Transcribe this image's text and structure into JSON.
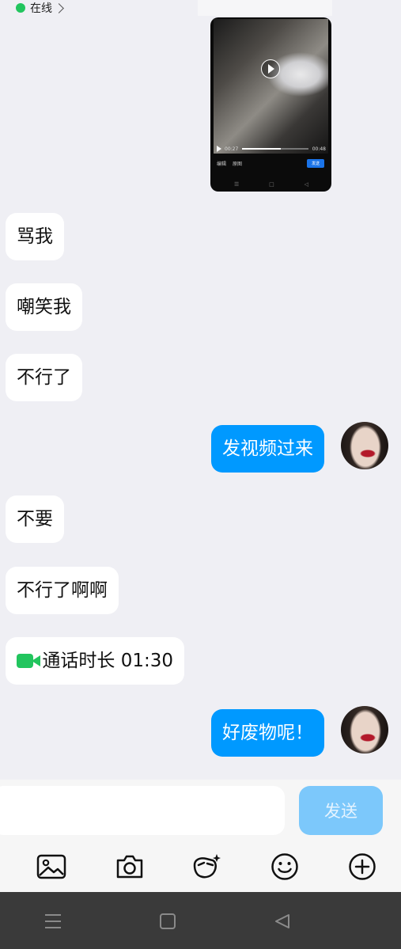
{
  "status": {
    "online_label": "在线"
  },
  "shared_screenshot": {
    "time_current": "00:27",
    "time_total": "00:48",
    "progress": 0.58,
    "edit_label": "编辑",
    "original_label": "原图",
    "send_label": "发送"
  },
  "messages": [
    {
      "side": "in",
      "text": "骂我"
    },
    {
      "side": "in",
      "text": "嘲笑我"
    },
    {
      "side": "in",
      "text": "不行了"
    },
    {
      "side": "out",
      "text": "发视频过来"
    },
    {
      "side": "in",
      "text": "不要"
    },
    {
      "side": "in",
      "text": "不行了啊啊"
    },
    {
      "side": "in",
      "text": "通话时长 01:30"
    },
    {
      "side": "out",
      "text": "好废物呢！"
    }
  ],
  "composer": {
    "input_value": "",
    "send_label": "发送"
  },
  "toolbar_icons": [
    "image-icon",
    "camera-icon",
    "sticker-icon",
    "emoji-icon",
    "plus-icon"
  ],
  "system_nav_icons": [
    "menu-icon",
    "home-icon",
    "back-icon"
  ],
  "colors": {
    "bubble_out": "#0099ff",
    "bubble_in": "#ffffff",
    "online": "#22c55e",
    "send_disabled": "#7cc8fb"
  }
}
